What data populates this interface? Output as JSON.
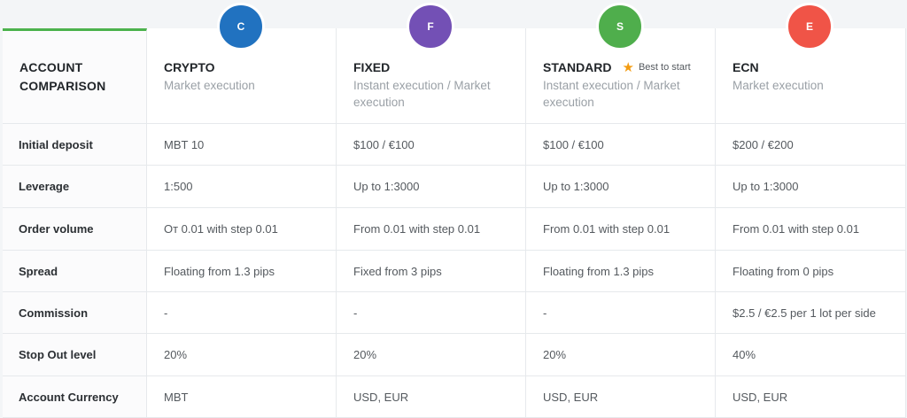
{
  "corner_title_line1": "ACCOUNT",
  "corner_title_line2": "COMPARISON",
  "accounts": [
    {
      "badge": "C",
      "name": "CRYPTO",
      "desc": "Market execution",
      "color": "#2172c0"
    },
    {
      "badge": "F",
      "name": "FIXED",
      "desc": "Instant execution / Market execution",
      "color": "#7350b5"
    },
    {
      "badge": "S",
      "name": "STANDARD",
      "desc": "Instant execution / Market execution",
      "color": "#4fae4c",
      "best": "Best to start"
    },
    {
      "badge": "E",
      "name": "ECN",
      "desc": "Market execution",
      "color": "#f05447"
    }
  ],
  "rows": [
    {
      "label": "Initial deposit",
      "values": [
        "MBT 10",
        "$100 / €100",
        "$100 / €100",
        "$200 / €200"
      ]
    },
    {
      "label": "Leverage",
      "values": [
        "1:500",
        "Up to 1:3000",
        "Up to 1:3000",
        "Up to 1:3000"
      ]
    },
    {
      "label": "Order volume",
      "values": [
        "От 0.01 with step 0.01",
        "From 0.01 with step 0.01",
        "From 0.01 with step 0.01",
        "From 0.01 with step 0.01"
      ]
    },
    {
      "label": "Spread",
      "values": [
        "Floating from 1.3 pips",
        "Fixed from 3 pips",
        "Floating from 1.3 pips",
        "Floating from 0 pips"
      ]
    },
    {
      "label": "Commission",
      "values": [
        "-",
        "-",
        "-",
        "$2.5 / €2.5 per 1 lot per side"
      ]
    },
    {
      "label": "Stop Out level",
      "values": [
        "20%",
        "20%",
        "20%",
        "40%"
      ]
    },
    {
      "label": "Account Currency",
      "values": [
        "MBT",
        "USD, EUR",
        "USD, EUR",
        "USD, EUR"
      ]
    }
  ]
}
